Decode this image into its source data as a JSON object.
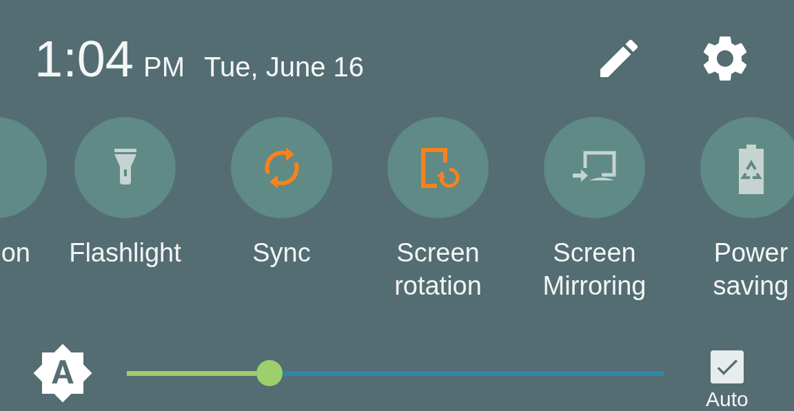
{
  "status": {
    "time": "1:04",
    "ampm": "PM",
    "date": "Tue, June 16"
  },
  "tiles": [
    {
      "kind": "partial",
      "label": "on",
      "on": false
    },
    {
      "kind": "tile",
      "label": "Flashlight",
      "on": false
    },
    {
      "kind": "tile",
      "label": "Sync",
      "on": true
    },
    {
      "kind": "tile",
      "label": "Screen rotation",
      "on": true
    },
    {
      "kind": "tile",
      "label": "Screen Mirroring",
      "on": false
    },
    {
      "kind": "tile",
      "label": "Power saving",
      "on": false
    }
  ],
  "brightness": {
    "level": 0.265
  },
  "auto": {
    "label": "Auto",
    "checked": true
  }
}
